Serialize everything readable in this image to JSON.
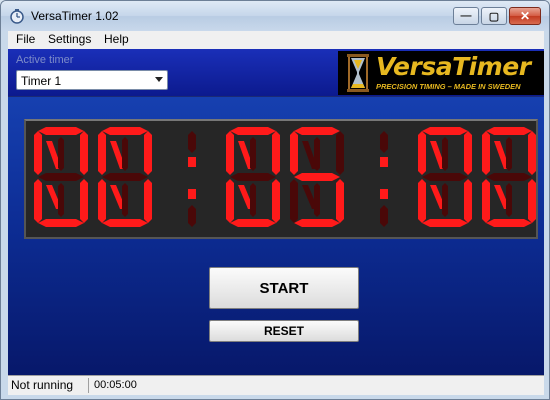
{
  "window": {
    "title": "VersaTimer 1.02"
  },
  "menu": {
    "file": "File",
    "settings": "Settings",
    "help": "Help"
  },
  "active_timer": {
    "label": "Active timer",
    "selected": "Timer 1"
  },
  "logo": {
    "name": "VersaTimer",
    "tagline": "PRECISION TIMING – MADE IN SWEDEN"
  },
  "display": {
    "digits": "00:05:00",
    "led_color": "#ff1a1a",
    "led_off_color": "#4a0808"
  },
  "buttons": {
    "start": "START",
    "reset": "RESET"
  },
  "status": {
    "state": "Not running",
    "time": "00:05:00"
  },
  "colors": {
    "panel_top": "#1a2fb8",
    "panel_bottom": "#07186a",
    "logo_gold": "#e7b820"
  }
}
